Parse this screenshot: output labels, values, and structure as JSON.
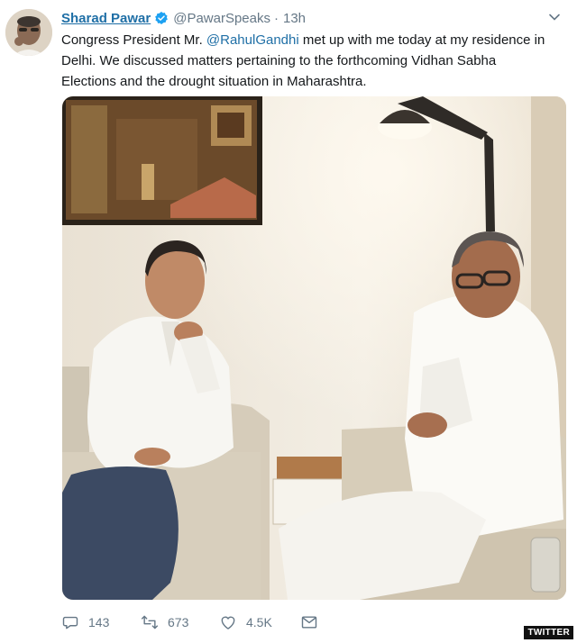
{
  "tweet": {
    "author_name": "Sharad Pawar",
    "handle": "@PawarSpeaks",
    "separator": "·",
    "time": "13h",
    "text_before_mention": "Congress President Mr. ",
    "mention": "@RahulGandhi",
    "text_line1_after": " met up with me today at my residence in",
    "text_line2": "Delhi. We discussed matters pertaining to the forthcoming Vidhan Sabha",
    "text_line3": "Elections and the drought situation in Maharashtra."
  },
  "actions": {
    "replies": "143",
    "retweets": "673",
    "likes": "4.5K"
  },
  "icons": [
    "verified-badge-icon",
    "chevron-down-icon",
    "reply-icon",
    "retweet-icon",
    "like-icon",
    "message-icon"
  ],
  "watermark": "TWITTER",
  "colors": {
    "link": "#1f6fa6",
    "muted": "#657786",
    "verified": "#1da1f2"
  }
}
